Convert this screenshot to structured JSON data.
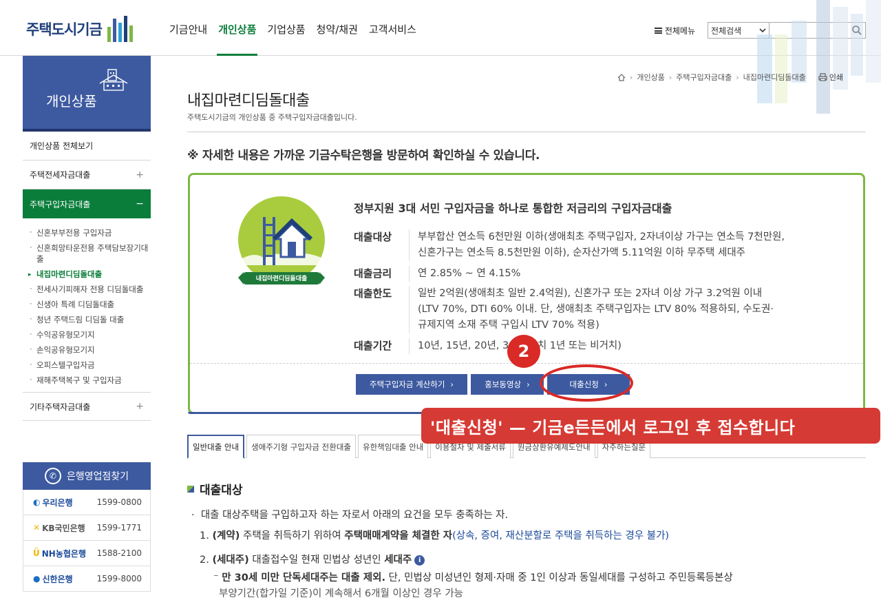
{
  "header": {
    "logo_text": "주택도시기금",
    "nav": [
      "기금안내",
      "개인상품",
      "기업상품",
      "청약/채권",
      "고객서비스"
    ],
    "active_nav": "개인상품",
    "all_menu": "전체메뉴",
    "search_scope": "전체검색",
    "search_placeholder": ""
  },
  "sidebar": {
    "title": "개인상품",
    "items": [
      {
        "label": "개인상품 전체보기",
        "toggle": ""
      },
      {
        "label": "주택전세자금대출",
        "toggle": "+"
      },
      {
        "label": "주택구입자금대출",
        "toggle": "−"
      }
    ],
    "sub_items": [
      "신혼부부전용 구입자금",
      "신혼희망타운전용 주택담보장기대출",
      "내집마련디딤돌대출",
      "전세사기피해자 전용 디딤돌대출",
      "신생아 특례 디딤돌대출",
      "청년 주택드림 디딤돌 대출",
      "수익공유형모기지",
      "손익공유형모기지",
      "오피스텔구입자금",
      "재해주택복구 및 구입자금"
    ],
    "current_sub": "내집마련디딤돌대출",
    "other": {
      "label": "기타주택자금대출",
      "toggle": "+"
    }
  },
  "bank_finder": {
    "title": "은행영업점찾기",
    "banks": [
      {
        "name": "우리은행",
        "tel": "1599-0800",
        "color": "#1b6fc2"
      },
      {
        "name": "KB국민은행",
        "tel": "1599-1771",
        "color": "#f2b600"
      },
      {
        "name": "NH농협은행",
        "tel": "1588-2100",
        "color": "#1b4a9a"
      },
      {
        "name": "신한은행",
        "tel": "1599-8000",
        "color": "#1b4a9a"
      }
    ]
  },
  "breadcrumb": [
    "개인상품",
    "주택구입자금대출",
    "내집마련디딤돌대출"
  ],
  "print_label": "인쇄",
  "page": {
    "title": "내집마련디딤돌대출",
    "desc": "주택도시기금의 개인상품 중 주택구입자금대출입니다.",
    "notice": "※ 자세한 내용은 가까운 기금수탁은행을 방문하여 확인하실 수 있습니다."
  },
  "product": {
    "badge_label": "내집마련디딤돌대출",
    "headline": "정부지원 3대 서민 구입자금을 하나로 통합한 저금리의 구입자금대출",
    "specs": [
      {
        "key": "대출대상",
        "lines": [
          "부부합산 연소득 6천만원 이하(생애최초 주택구입자, 2자녀이상 가구는 연소득 7천만원,",
          "신혼가구는 연소득 8.5천만원 이하), 순자산가액 5.11억원 이하 무주택 세대주"
        ]
      },
      {
        "key": "대출금리",
        "lines": [
          "연 2.85% ~ 연 4.15%"
        ]
      },
      {
        "key": "대출한도",
        "lines": [
          "일반 2억원(생애최초 일반 2.4억원), 신혼가구 또는 2자녀 이상 가구 3.2억원 이내",
          "(LTV 70%, DTI 60% 이내. 단, 생애최초 주택구입자는 LTV 80% 적용하되, 수도권·",
          "규제지역 소재 주택 구입시 LTV 70% 적용)"
        ]
      },
      {
        "key": "대출기간",
        "lines": [
          "10년, 15년, 20년, 30년(거치 1년 또는 비거치)"
        ]
      }
    ],
    "buttons": [
      "주택구입자금 계산하기",
      "홍보동영상",
      "대출신청"
    ]
  },
  "tabs": [
    "일반대출 안내",
    "생애주기형 구입자금 전환대출",
    "유한책임대출 안내",
    "이용절차 및 제출서류",
    "원금상환유예제도안내",
    "자주하는질문"
  ],
  "section": {
    "title": "대출대상",
    "intro": "대출 대상주택을 구입하고자 하는 자로서 아래의 요건을 모두 충족하는 자.",
    "item1": {
      "num": "1.",
      "tag": "(계약)",
      "text": " 주택을 취득하기 위하여 ",
      "bold": "주택매매계약을 체결한 자",
      "note": "(상속, 증여, 재산분할로 주택을 취득하는 경우 불가)"
    },
    "item2": {
      "num": "2.",
      "tag": "(세대주)",
      "text": " 대출접수일 현재 민법상 성년인 ",
      "bold": "세대주"
    },
    "item2_sub_bold": "만 30세 미만 단독세대주는 대출 제외.",
    "item2_sub_rest": " 단, 민법상 미성년인 형제·자매 중 1인 이상과 동일세대를 구성하고 주민등록등본상",
    "item2_sub_cut": "부양기간(합가일 기준)이 계속해서 6개월 이상인 경우 가능"
  },
  "annotation": {
    "step": "2",
    "callout": "'대출신청' — 기금e든든에서 로그인 후 접수합니다"
  }
}
